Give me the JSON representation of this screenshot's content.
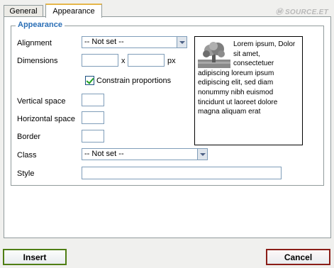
{
  "tabs": {
    "general": "General",
    "appearance": "Appearance"
  },
  "brand": {
    "logo_text": "Ⓜ SOURCE.ET"
  },
  "appearance": {
    "legend": "Appearance",
    "alignment_label": "Alignment",
    "alignment_value": "-- Not set --",
    "dimensions_label": "Dimensions",
    "dimensions_x": "x",
    "dimensions_unit": "px",
    "constrain_label": "Constrain proportions",
    "constrain_checked": true,
    "vspace_label": "Vertical space",
    "hspace_label": "Horizontal space",
    "border_label": "Border",
    "class_label": "Class",
    "class_value": "-- Not set --",
    "style_label": "Style",
    "preview_text": "Lorem ipsum, Dolor sit amet, consectetuer adipiscing loreum ipsum edipiscing elit, sed diam nonummy nibh euismod tincidunt ut laoreet dolore magna aliquam erat"
  },
  "buttons": {
    "insert": "Insert",
    "cancel": "Cancel"
  },
  "colors": {
    "legend": "#2b6fb6",
    "insert_border": "#4f7e14",
    "cancel_border": "#8a1d17",
    "active_tab_top": "#e6b64a"
  }
}
